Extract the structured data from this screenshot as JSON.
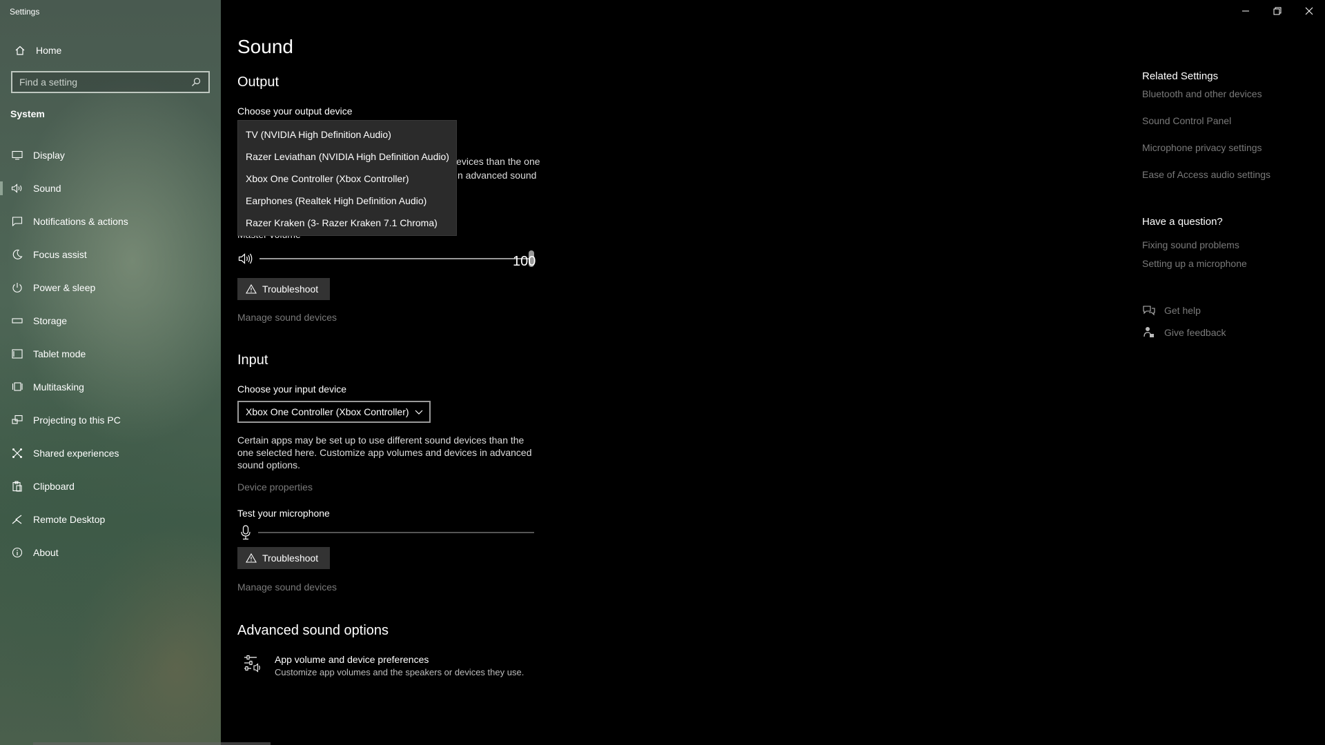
{
  "app": {
    "title": "Settings"
  },
  "sidebar": {
    "home": {
      "label": "Home",
      "icon": "home-icon"
    },
    "search": {
      "placeholder": "Find a setting",
      "icon": "search-icon"
    },
    "section": "System",
    "items": [
      {
        "label": "Display",
        "icon": "display-icon"
      },
      {
        "label": "Sound",
        "icon": "speaker-icon",
        "selected": true
      },
      {
        "label": "Notifications & actions",
        "icon": "notifications-icon"
      },
      {
        "label": "Focus assist",
        "icon": "moon-icon"
      },
      {
        "label": "Power & sleep",
        "icon": "power-icon"
      },
      {
        "label": "Storage",
        "icon": "storage-icon"
      },
      {
        "label": "Tablet mode",
        "icon": "tablet-icon"
      },
      {
        "label": "Multitasking",
        "icon": "multitasking-icon"
      },
      {
        "label": "Projecting to this PC",
        "icon": "projecting-icon"
      },
      {
        "label": "Shared experiences",
        "icon": "shared-icon"
      },
      {
        "label": "Clipboard",
        "icon": "clipboard-icon"
      },
      {
        "label": "Remote Desktop",
        "icon": "remote-desktop-icon"
      },
      {
        "label": "About",
        "icon": "info-icon"
      }
    ]
  },
  "main": {
    "title": "Sound",
    "output": {
      "heading": "Output",
      "choose_label": "Choose your output device",
      "dropdown_options": [
        "TV (NVIDIA High Definition Audio)",
        "Razer Leviathan (NVIDIA High Definition Audio)",
        "Xbox One Controller (Xbox Controller)",
        "Earphones (Realtek High Definition Audio)",
        "Razer Kraken (3- Razer Kraken 7.1 Chroma)"
      ],
      "partial_desc_line1": "levices than the one",
      "partial_desc_line2": "n advanced sound",
      "master_volume_partial": "Master volume",
      "volume_value": "100",
      "volume_level": 100,
      "troubleshoot_label": "Troubleshoot",
      "manage_label": "Manage sound devices"
    },
    "input": {
      "heading": "Input",
      "choose_label": "Choose your input device",
      "selected_device": "Xbox One Controller (Xbox Controller)",
      "description": "Certain apps may be set up to use different sound devices than the one selected here. Customize app volumes and devices in advanced sound options.",
      "device_properties": "Device properties",
      "test_label": "Test your microphone",
      "mic_level": 0,
      "troubleshoot_label": "Troubleshoot",
      "manage_label": "Manage sound devices"
    },
    "advanced": {
      "heading": "Advanced sound options",
      "pref_title": "App volume and device preferences",
      "pref_desc": "Customize app volumes and the speakers or devices they use."
    }
  },
  "right": {
    "related_heading": "Related Settings",
    "related_links": [
      "Bluetooth and other devices",
      "Sound Control Panel",
      "Microphone privacy settings",
      "Ease of Access audio settings"
    ],
    "question_heading": "Have a question?",
    "question_links": [
      "Fixing sound problems",
      "Setting up a microphone"
    ],
    "get_help": "Get help",
    "give_feedback": "Give feedback"
  }
}
